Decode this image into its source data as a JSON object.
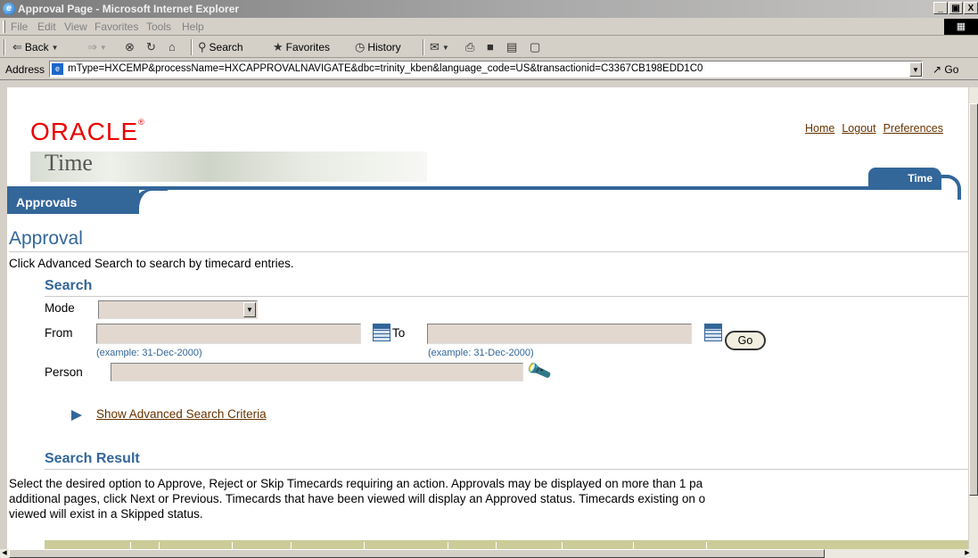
{
  "window": {
    "title": "Approval Page - Microsoft Internet Explorer",
    "icon": "ie-logo-icon",
    "buttons": [
      "_",
      "ɨ",
      "X"
    ]
  },
  "menu": [
    "File",
    "Edit",
    "View",
    "Favorites",
    "Tools",
    "Help"
  ],
  "toolbar": {
    "back": "Back",
    "search": "Search",
    "favorites": "Favorites",
    "history": "History"
  },
  "address": {
    "label": "Address",
    "url": "mType=HXCEMP&processName=HXCAPPROVALNAVIGATE&dbc=trinity_kben&language_code=US&transactionid=C3367CB198EDD1C0",
    "go": "Go"
  },
  "brand": {
    "logo": "ORACLE",
    "product": "Time"
  },
  "global_links": [
    "Home",
    "Logout",
    "Preferences"
  ],
  "tabs": {
    "main": "Time",
    "sub": "Approvals"
  },
  "page": {
    "title": "Approval",
    "instruction": "Click Advanced Search to search by timecard entries."
  },
  "search": {
    "heading": "Search",
    "mode_label": "Mode",
    "mode_value": "",
    "from_label": "From",
    "to_label": "To",
    "from_value": "",
    "to_value": "",
    "date_hint": "(example: 31-Dec-2000)",
    "go_label": "Go",
    "person_label": "Person",
    "person_value": "",
    "advanced_link": "Show Advanced Search Criteria"
  },
  "result": {
    "heading": "Search Result",
    "lines": [
      "Select the desired option to Approve, Reject or Skip Timecards requiring an action. Approvals may be displayed on more than 1 pa",
      "additional pages, click Next or Previous. Timecards that have been viewed will display an Approved status. Timecards existing on o",
      "viewed will exist in a Skipped status."
    ]
  },
  "colors": {
    "oracle_red": "#e00000",
    "brand_blue": "#336699",
    "link_brown": "#663300",
    "field_bg": "#e2d8cf",
    "table_header": "#cccc99"
  }
}
